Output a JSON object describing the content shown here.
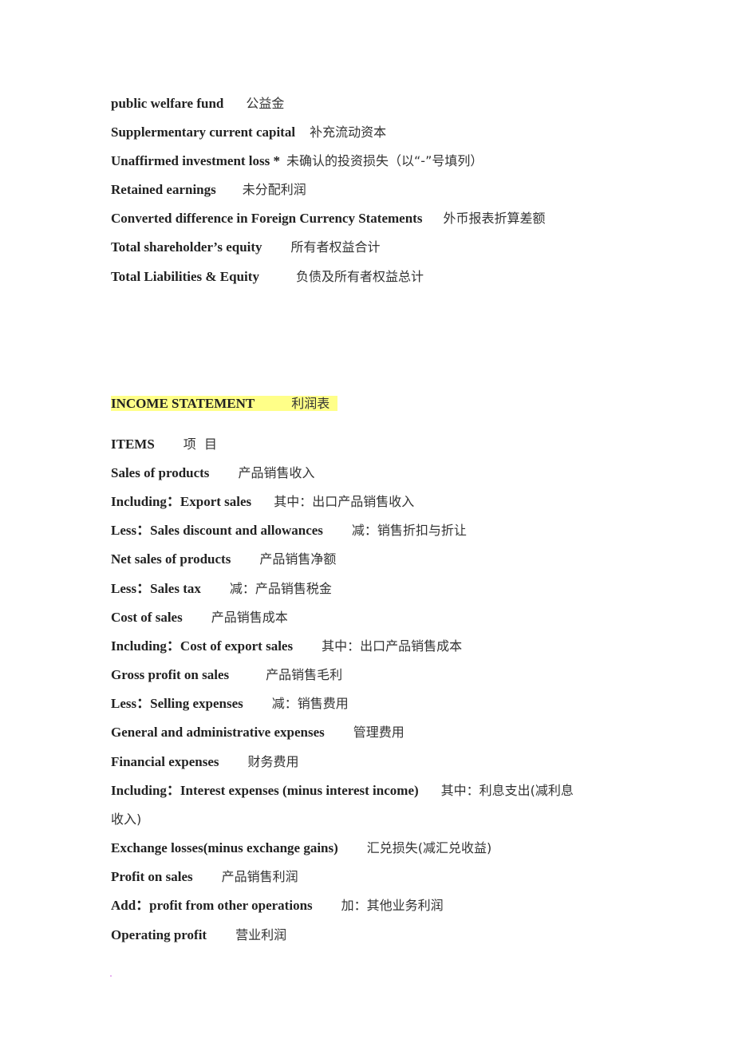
{
  "balance_sheet_tail": [
    {
      "en": "public welfare fund",
      "zh": "公益金"
    },
    {
      "en": "Supplermentary current capital",
      "zh": "补充流动资本"
    },
    {
      "en": "Unaffirmed investment loss *",
      "zh": "未确认的投资损失（以“-”号填列）"
    },
    {
      "en": "Retained earnings",
      "zh": "未分配利润"
    },
    {
      "en": "Converted difference in Foreign Currency Statements",
      "zh": "外币报表折算差额"
    },
    {
      "en": "Total shareholder’s equity",
      "zh": "所有者权益合计"
    },
    {
      "en": "Total Liabilities & Equity",
      "zh": "负债及所有者权益总计"
    }
  ],
  "income_statement": {
    "heading_en": "INCOME STATEMENT",
    "heading_zh": "利润表",
    "items_header": {
      "en": "ITEMS",
      "zh": "项  目"
    },
    "items": [
      {
        "en": "Sales of products",
        "zh": "产品销售收入"
      },
      {
        "en": "Including：Export sales",
        "zh": "其中：出口产品销售收入"
      },
      {
        "en": "Less：Sales discount and allowances",
        "zh": "减：销售折扣与折让"
      },
      {
        "en": "Net sales of products",
        "zh": "产品销售净额"
      },
      {
        "en": "Less：Sales tax",
        "zh": "减：产品销售税金"
      },
      {
        "en": "Cost of sales",
        "zh": "产品销售成本"
      },
      {
        "en": "Including：Cost of export sales",
        "zh": "其中：出口产品销售成本"
      },
      {
        "en": "Gross profit on sales",
        "zh": "产品销售毛利"
      },
      {
        "en": "Less：Selling expenses",
        "zh": "减：销售费用"
      },
      {
        "en": "General and administrative expenses",
        "zh": "管理费用"
      },
      {
        "en": "Financial expenses",
        "zh": "财务费用"
      },
      {
        "en": "Including：Interest expenses (minus interest income)",
        "zh": "其中：利息支出(减利息",
        "zh_cont": "收入)"
      },
      {
        "en": "Exchange losses(minus exchange gains)",
        "zh": "汇兑损失(减汇兑收益)"
      },
      {
        "en": "Profit on sales",
        "zh": "产品销售利润"
      },
      {
        "en": "Add：profit from other operations",
        "zh": "加：其他业务利润"
      },
      {
        "en": "Operating profit",
        "zh": "营业利润"
      }
    ]
  }
}
